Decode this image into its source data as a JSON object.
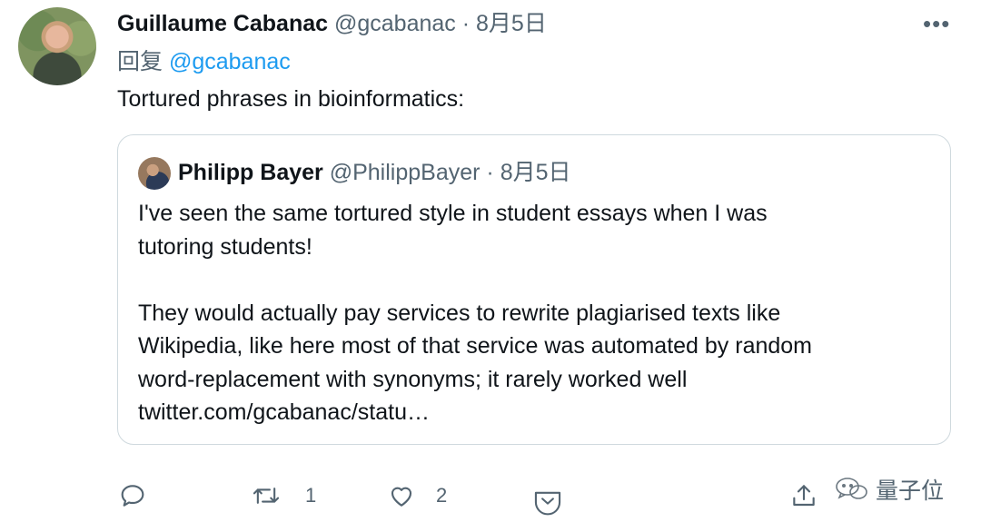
{
  "author": {
    "name": "Guillaume Cabanac",
    "handle": "@gcabanac",
    "separator": "·",
    "date": "8月5日"
  },
  "reply": {
    "prefix": "回复",
    "mention": "@gcabanac"
  },
  "tweet_text": "Tortured phrases in bioinformatics:",
  "quoted_tweet": {
    "name": "Philipp Bayer",
    "handle": "@PhilippBayer",
    "separator": "·",
    "date": "8月5日",
    "lines_para1": [
      "I've seen the same tortured style in student essays when I was",
      "tutoring students!"
    ],
    "lines_para2": [
      "They would actually pay services to rewrite plagiarised texts like",
      "Wikipedia, like here most of that service was automated by random",
      "word-replacement with synonyms; it rarely worked well",
      "twitter.com/gcabanac/statu…"
    ]
  },
  "actions": {
    "reply_icon": "speech-bubble-icon",
    "retweet_icon": "retweet-icon",
    "retweet_count": "1",
    "like_icon": "heart-icon",
    "like_count": "2",
    "tip_icon": "chevron-badge-icon",
    "share_icon": "share-upload-icon"
  },
  "more_icon": "ellipsis-icon",
  "watermark": {
    "icon": "wechat-icon",
    "text": "量子位"
  },
  "colors": {
    "text": "#0f1419",
    "muted": "#536471",
    "link": "#1d9bf0",
    "border": "#cfd9de"
  }
}
